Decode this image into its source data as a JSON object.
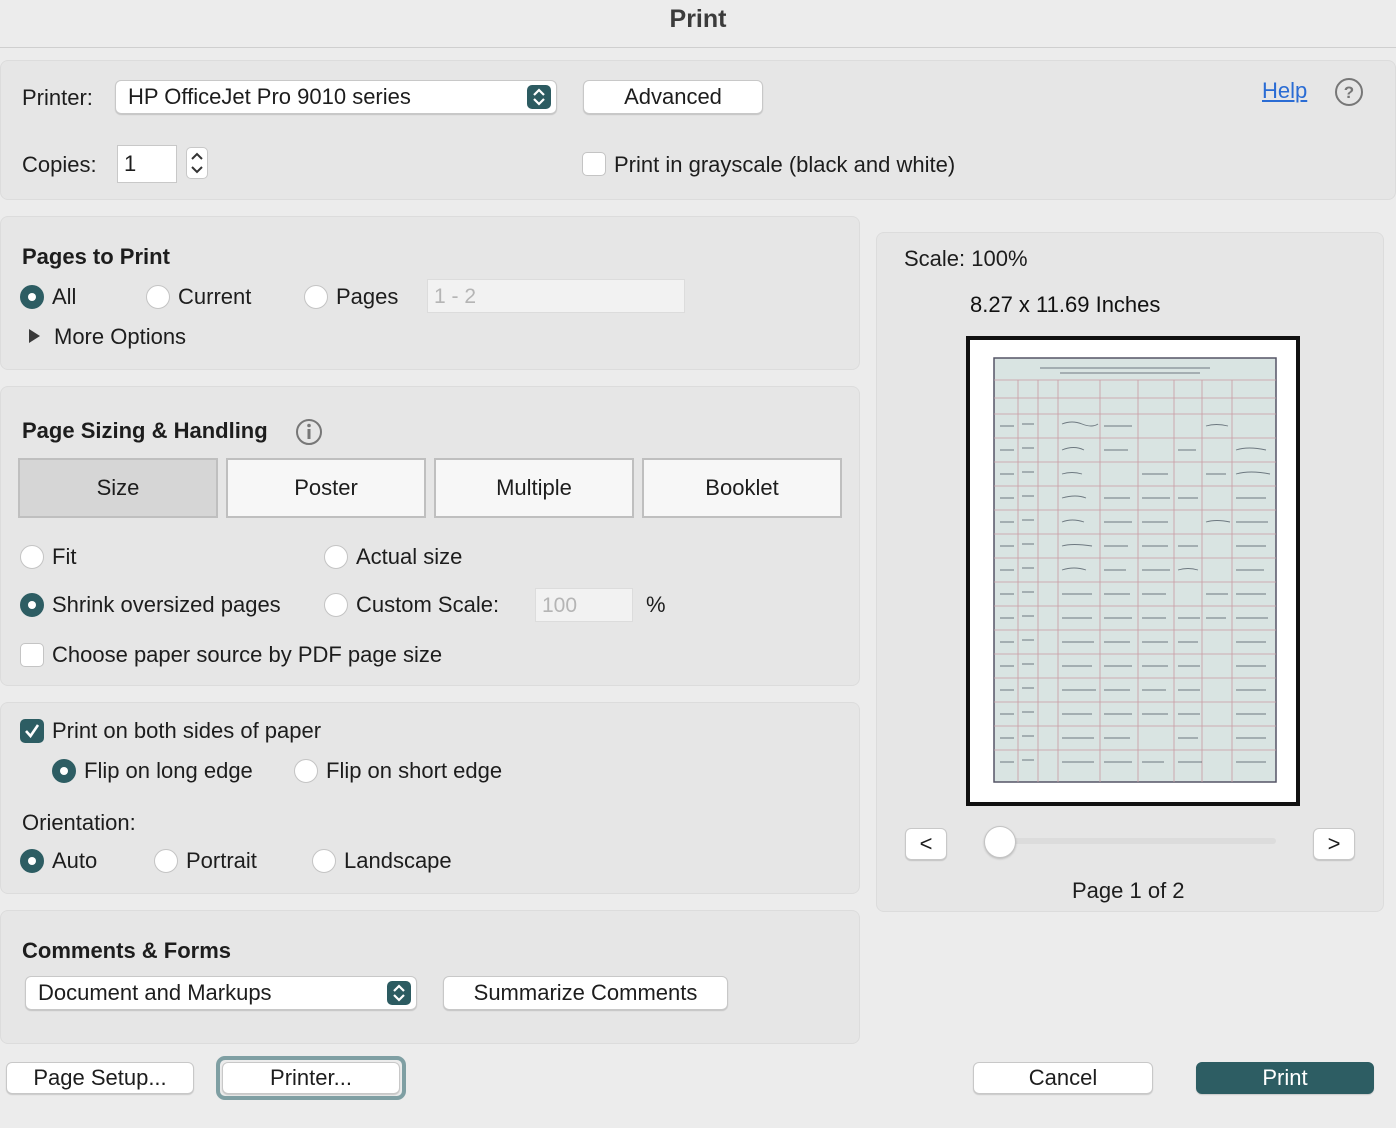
{
  "dialog": {
    "title": "Print"
  },
  "top": {
    "printer_label": "Printer:",
    "printer_value": "HP OfficeJet Pro 9010 series",
    "advanced_label": "Advanced",
    "help_label": "Help",
    "copies_label": "Copies:",
    "copies_value": "1",
    "grayscale_label": "Print in grayscale (black and white)",
    "grayscale_checked": false
  },
  "pages_to_print": {
    "heading": "Pages to Print",
    "options": [
      "All",
      "Current",
      "Pages"
    ],
    "selected": "All",
    "range_placeholder": "1 - 2",
    "more_options_label": "More Options"
  },
  "page_sizing": {
    "heading": "Page Sizing & Handling",
    "tabs": [
      "Size",
      "Poster",
      "Multiple",
      "Booklet"
    ],
    "active_tab": "Size",
    "fit_label": "Fit",
    "actual_size_label": "Actual size",
    "shrink_label": "Shrink oversized pages",
    "custom_scale_label": "Custom Scale:",
    "custom_scale_value": "100",
    "percent_sign": "%",
    "selected": "Shrink oversized pages",
    "paper_source_label": "Choose paper source by PDF page size",
    "paper_source_checked": false
  },
  "duplex": {
    "both_sides_label": "Print on both sides of paper",
    "both_sides_checked": true,
    "flip_long_label": "Flip on long edge",
    "flip_short_label": "Flip on short edge",
    "flip_selected": "Flip on long edge",
    "orientation_label": "Orientation:",
    "orientations": [
      "Auto",
      "Portrait",
      "Landscape"
    ],
    "orientation_selected": "Auto"
  },
  "comments_forms": {
    "heading": "Comments & Forms",
    "select_value": "Document and Markups",
    "summarize_label": "Summarize Comments"
  },
  "preview": {
    "scale_text": "Scale: 100%",
    "size_text": "8.27 x 11.69 Inches",
    "prev_label": "<",
    "next_label": ">",
    "page_indicator": "Page 1 of 2",
    "slider_position": 0
  },
  "footer": {
    "page_setup_label": "Page Setup...",
    "printer_label": "Printer...",
    "cancel_label": "Cancel",
    "print_label": "Print"
  },
  "colors": {
    "accent": "#2d5d63",
    "link": "#2a6cd4",
    "panel": "#e6e6e6",
    "background": "#ececec"
  }
}
